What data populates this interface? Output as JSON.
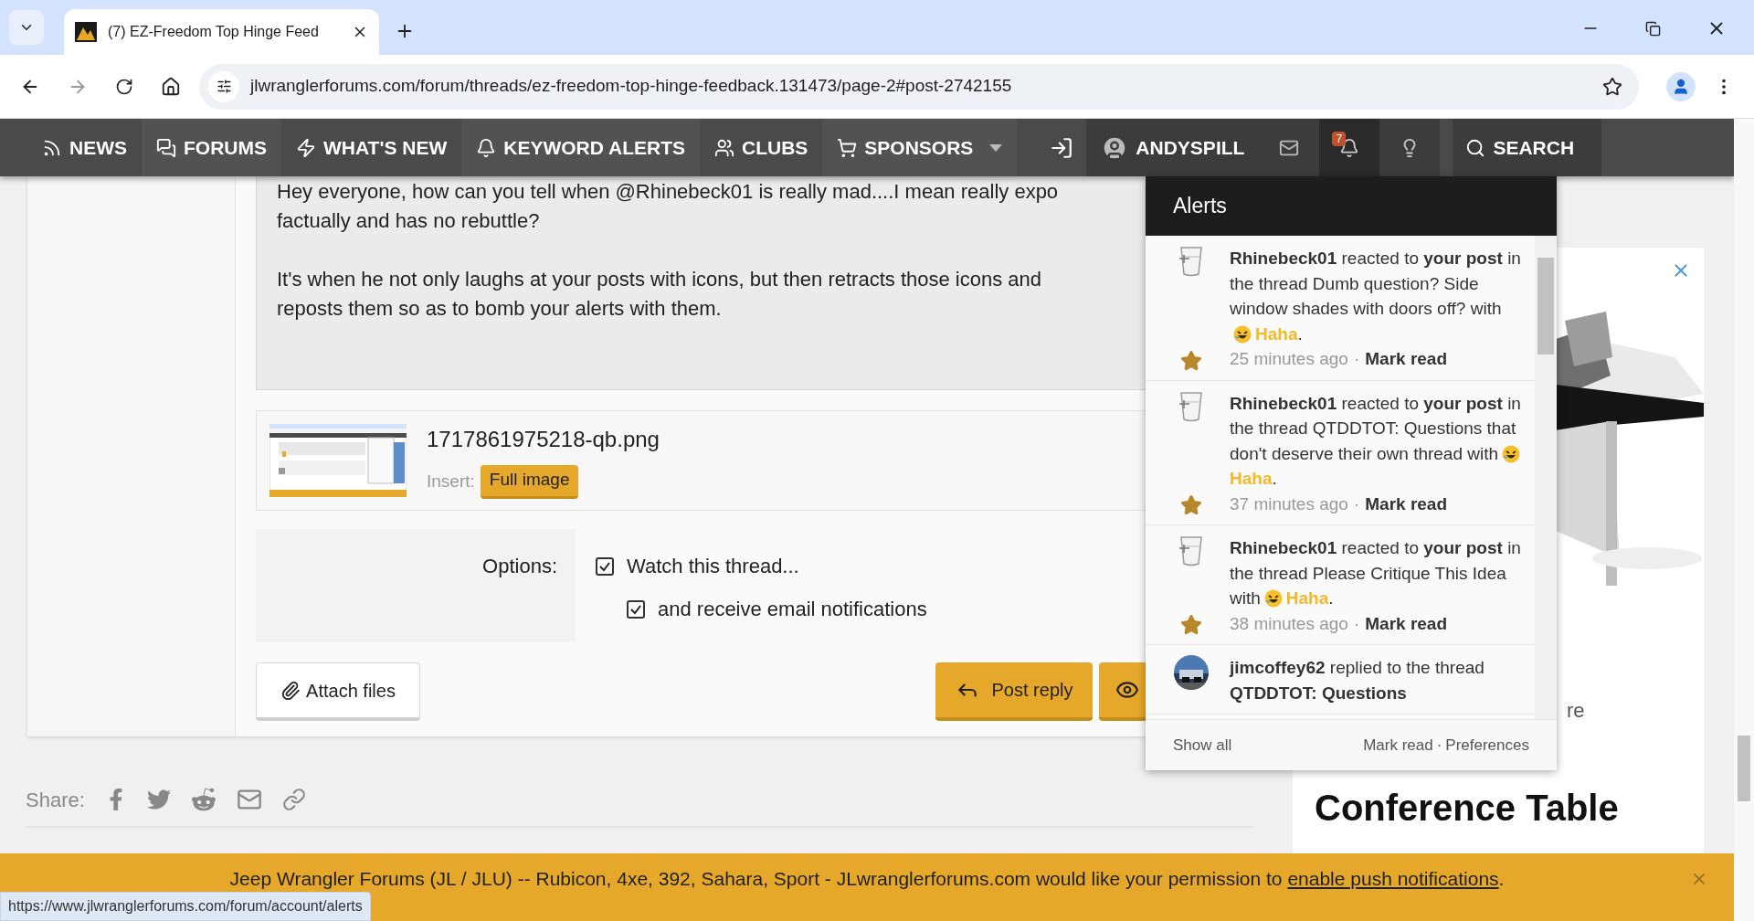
{
  "browser": {
    "tab_title": "(7) EZ-Freedom Top Hinge Feed",
    "url": "jlwranglerforums.com/forum/threads/ez-freedom-top-hinge-feedback.131473/page-2#post-2742155"
  },
  "nav": {
    "items": [
      {
        "label": "NEWS"
      },
      {
        "label": "FORUMS"
      },
      {
        "label": "WHAT'S NEW"
      },
      {
        "label": "KEYWORD ALERTS"
      },
      {
        "label": "CLUBS"
      },
      {
        "label": "SPONSORS"
      }
    ],
    "user": "ANDYSPILL",
    "badge": "7",
    "search": "SEARCH"
  },
  "post": {
    "paragraphs": [
      [
        "Hey everyone, how can you tell when @Rhinebeck01 is really mad....I mean really expo",
        "factually and has no rebuttle?"
      ],
      [
        "It's when he not only laughs at your posts with icons, but then retracts those icons and",
        "reposts them so as to bomb your alerts with them."
      ]
    ]
  },
  "attachment": {
    "filename": "1717861975218-qb.png",
    "insert_label": "Insert:",
    "button": "Full image"
  },
  "options": {
    "label": "Options:",
    "checkboxes": [
      {
        "label": "Watch this thread...",
        "checked": true
      },
      {
        "label": "and receive email notifications",
        "checked": true
      }
    ]
  },
  "buttons": {
    "attach": "Attach files",
    "post": "Post reply"
  },
  "share": {
    "label": "Share:"
  },
  "ad": {
    "fragment": "re",
    "headline": "Conference Table"
  },
  "alerts": {
    "open": true,
    "title": "Alerts",
    "items": [
      {
        "kind": "reaction",
        "message": "**Rhinebeck01** reacted to **your post** in the thread Dumb question? Side window shades with doors off? with",
        "reaction": "Haha",
        "end": ".",
        "time": "25 minutes ago",
        "separator": "·",
        "action": "Mark read",
        "unread": true
      },
      {
        "kind": "reaction",
        "message": "**Rhinebeck01** reacted to **your post** in the thread QTDDTOT: Questions that don't deserve their own thread with",
        "reaction": "Haha",
        "end": ".",
        "time": "37 minutes ago",
        "separator": "·",
        "action": "Mark read",
        "unread": true
      },
      {
        "kind": "reaction",
        "message": "**Rhinebeck01** reacted to **your post** in the thread Please Critique This Idea with",
        "reaction": "Haha",
        "end": ".",
        "time": "38 minutes ago",
        "separator": "·",
        "action": "Mark read",
        "unread": true
      },
      {
        "kind": "reply",
        "message": "**jimcoffey62** replied to the thread **QTDDTOT: Questions**"
      }
    ],
    "footer": {
      "show_all": "Show all",
      "mark_read": "Mark read",
      "separator": "·",
      "preferences": "Preferences"
    }
  },
  "push_bar": {
    "text": "Jeep Wrangler Forums (JL / JLU) -- Rubicon, 4xe, 392, Sahara, Sport - JLwranglerforums.com would like your permission to",
    "link": "enable push notifications",
    "end": "."
  },
  "status_url": "https://www.jlwranglerforums.com/forum/account/alerts"
}
